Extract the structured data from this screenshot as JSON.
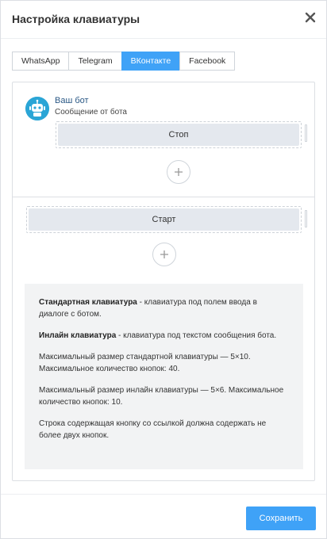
{
  "dialog": {
    "title": "Настройка клавиатуры",
    "close_icon": "close-icon"
  },
  "tabs": [
    {
      "label": "WhatsApp",
      "active": false
    },
    {
      "label": "Telegram",
      "active": false
    },
    {
      "label": "ВКонтакте",
      "active": true
    },
    {
      "label": "Facebook",
      "active": false
    }
  ],
  "message": {
    "bot_name": "Ваш бот",
    "text": "Сообщение от бота",
    "inline_buttons": [
      "Стоп"
    ]
  },
  "standard_keyboard": {
    "buttons": [
      "Старт"
    ]
  },
  "info": {
    "standard_title": "Стандартная клавиатура",
    "standard_desc": " - клавиатура под полем ввода в диалоге с ботом.",
    "inline_title": "Инлайн клавиатура",
    "inline_desc": " - клавиатура под текстом сообщения бота.",
    "standard_limits": "Максимальный размер стандартной клавиатуры — 5×10. Максимальное количество кнопок: 40.",
    "inline_limits": "Максимальный размер инлайн клавиатуры — 5×6. Максимальное количество кнопок: 10.",
    "link_note": "Строка содержащая кнопку со ссылкой должна содержать не более двух кнопок."
  },
  "footer": {
    "save_label": "Сохранить"
  },
  "colors": {
    "accent": "#3fa2f7",
    "avatar": "#2aa5d6",
    "info_bg": "#f2f3f4"
  }
}
